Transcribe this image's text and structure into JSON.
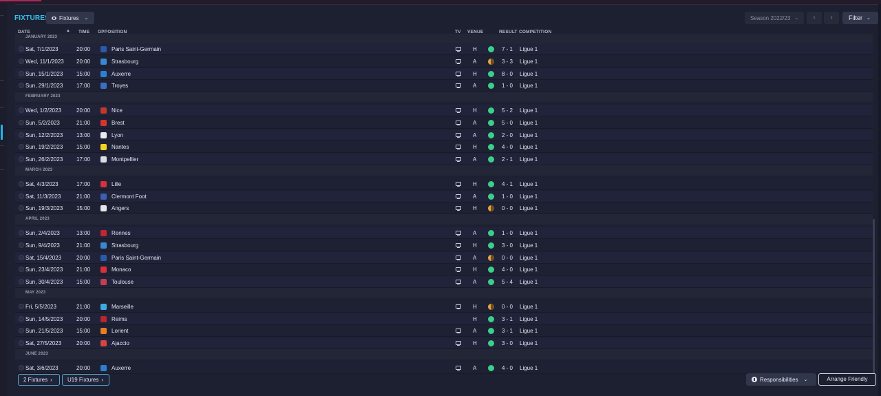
{
  "header": {
    "title": "FIXTURES",
    "view_dropdown": "Fixtures",
    "season": "Season 2022/23",
    "prev_icon": "chevron-left-icon",
    "next_icon": "chevron-right-icon",
    "filter_label": "Filter"
  },
  "columns": {
    "date": "DATE",
    "time": "TIME",
    "opposition": "OPPOSITION",
    "tv": "TV",
    "venue": "VENUE",
    "result": "RESULT",
    "competition": "COMPETITION"
  },
  "colors": {
    "accent": "#39c3ef",
    "win": "#3bd08a",
    "draw": "#e9a43e",
    "background": "#1d2031"
  },
  "months": [
    "JANUARY 2023",
    "FEBRUARY 2023",
    "MARCH 2023",
    "APRIL 2023",
    "MAY 2023",
    "JUNE 2023"
  ],
  "fixtures": [
    {
      "date": "Sat, 7/1/2023",
      "time": "20:00",
      "opponent": "Paris Saint-Germain",
      "crest": "#2a5aa8",
      "tv": true,
      "venue": "H",
      "outcome": "win",
      "score": "7 - 1",
      "competition": "Ligue 1"
    },
    {
      "date": "Wed, 11/1/2023",
      "time": "20:00",
      "opponent": "Strasbourg",
      "crest": "#3a88d4",
      "tv": true,
      "venue": "A",
      "outcome": "draw",
      "score": "3 - 3",
      "competition": "Ligue 1"
    },
    {
      "date": "Sun, 15/1/2023",
      "time": "15:00",
      "opponent": "Auxerre",
      "crest": "#2c7fd1",
      "tv": true,
      "venue": "H",
      "outcome": "win",
      "score": "8 - 0",
      "competition": "Ligue 1"
    },
    {
      "date": "Sun, 29/1/2023",
      "time": "17:00",
      "opponent": "Troyes",
      "crest": "#3a6fc4",
      "tv": true,
      "venue": "A",
      "outcome": "win",
      "score": "1 - 0",
      "competition": "Ligue 1"
    },
    {
      "date": "Wed, 1/2/2023",
      "time": "20:00",
      "opponent": "Nice",
      "crest": "#c0392b",
      "tv": true,
      "venue": "H",
      "outcome": "win",
      "score": "5 - 2",
      "competition": "Ligue 1"
    },
    {
      "date": "Sun, 5/2/2023",
      "time": "21:00",
      "opponent": "Brest",
      "crest": "#d9322f",
      "tv": true,
      "venue": "A",
      "outcome": "win",
      "score": "5 - 0",
      "competition": "Ligue 1"
    },
    {
      "date": "Sun, 12/2/2023",
      "time": "13:00",
      "opponent": "Lyon",
      "crest": "#e9e9ee",
      "tv": true,
      "venue": "A",
      "outcome": "win",
      "score": "2 - 0",
      "competition": "Ligue 1"
    },
    {
      "date": "Sun, 19/2/2023",
      "time": "15:00",
      "opponent": "Nantes",
      "crest": "#f2d220",
      "tv": true,
      "venue": "H",
      "outcome": "win",
      "score": "4 - 0",
      "competition": "Ligue 1"
    },
    {
      "date": "Sun, 26/2/2023",
      "time": "17:00",
      "opponent": "Montpellier",
      "crest": "#dcdce4",
      "tv": true,
      "venue": "A",
      "outcome": "win",
      "score": "2 - 1",
      "competition": "Ligue 1"
    },
    {
      "date": "Sat, 4/3/2023",
      "time": "17:00",
      "opponent": "Lille",
      "crest": "#d8303c",
      "tv": true,
      "venue": "H",
      "outcome": "win",
      "score": "4 - 1",
      "competition": "Ligue 1"
    },
    {
      "date": "Sat, 11/3/2023",
      "time": "21:00",
      "opponent": "Clermont Foot",
      "crest": "#3d5fb0",
      "tv": true,
      "venue": "A",
      "outcome": "win",
      "score": "1 - 0",
      "competition": "Ligue 1"
    },
    {
      "date": "Sun, 19/3/2023",
      "time": "15:00",
      "opponent": "Angers",
      "crest": "#e6e6ea",
      "tv": true,
      "venue": "H",
      "outcome": "draw",
      "score": "0 - 0",
      "competition": "Ligue 1"
    },
    {
      "date": "Sun, 2/4/2023",
      "time": "13:00",
      "opponent": "Rennes",
      "crest": "#c4262e",
      "tv": true,
      "venue": "A",
      "outcome": "win",
      "score": "1 - 0",
      "competition": "Ligue 1"
    },
    {
      "date": "Sun, 9/4/2023",
      "time": "21:00",
      "opponent": "Strasbourg",
      "crest": "#3a88d4",
      "tv": true,
      "venue": "H",
      "outcome": "win",
      "score": "3 - 0",
      "competition": "Ligue 1"
    },
    {
      "date": "Sat, 15/4/2023",
      "time": "20:00",
      "opponent": "Paris Saint-Germain",
      "crest": "#2a5aa8",
      "tv": true,
      "venue": "A",
      "outcome": "draw",
      "score": "0 - 0",
      "competition": "Ligue 1"
    },
    {
      "date": "Sun, 23/4/2023",
      "time": "21:00",
      "opponent": "Monaco",
      "crest": "#d9303a",
      "tv": true,
      "venue": "H",
      "outcome": "win",
      "score": "4 - 0",
      "competition": "Ligue 1"
    },
    {
      "date": "Sun, 30/4/2023",
      "time": "15:00",
      "opponent": "Toulouse",
      "crest": "#c43d54",
      "tv": true,
      "venue": "A",
      "outcome": "win",
      "score": "5 - 4",
      "competition": "Ligue 1"
    },
    {
      "date": "Fri, 5/5/2023",
      "time": "21:00",
      "opponent": "Marseille",
      "crest": "#3fa9e0",
      "tv": true,
      "venue": "H",
      "outcome": "draw",
      "score": "0 - 0",
      "competition": "Ligue 1"
    },
    {
      "date": "Sun, 14/5/2023",
      "time": "20:00",
      "opponent": "Reims",
      "crest": "#b8262e",
      "tv": false,
      "venue": "H",
      "outcome": "win",
      "score": "3 - 1",
      "competition": "Ligue 1"
    },
    {
      "date": "Sun, 21/5/2023",
      "time": "15:00",
      "opponent": "Lorient",
      "crest": "#e67e22",
      "tv": true,
      "venue": "A",
      "outcome": "win",
      "score": "3 - 1",
      "competition": "Ligue 1"
    },
    {
      "date": "Sat, 27/5/2023",
      "time": "20:00",
      "opponent": "Ajaccio",
      "crest": "#d64541",
      "tv": true,
      "venue": "H",
      "outcome": "win",
      "score": "3 - 0",
      "competition": "Ligue 1"
    },
    {
      "date": "Sat, 3/6/2023",
      "time": "20:00",
      "opponent": "Auxerre",
      "crest": "#2c7fd1",
      "tv": true,
      "venue": "A",
      "outcome": "win",
      "score": "4 - 0",
      "competition": "Ligue 1"
    }
  ],
  "footer": {
    "link1": "2 Fixtures",
    "link2": "U19 Fixtures",
    "responsibilities": "Responsibilities",
    "arrange": "Arrange Friendly"
  }
}
